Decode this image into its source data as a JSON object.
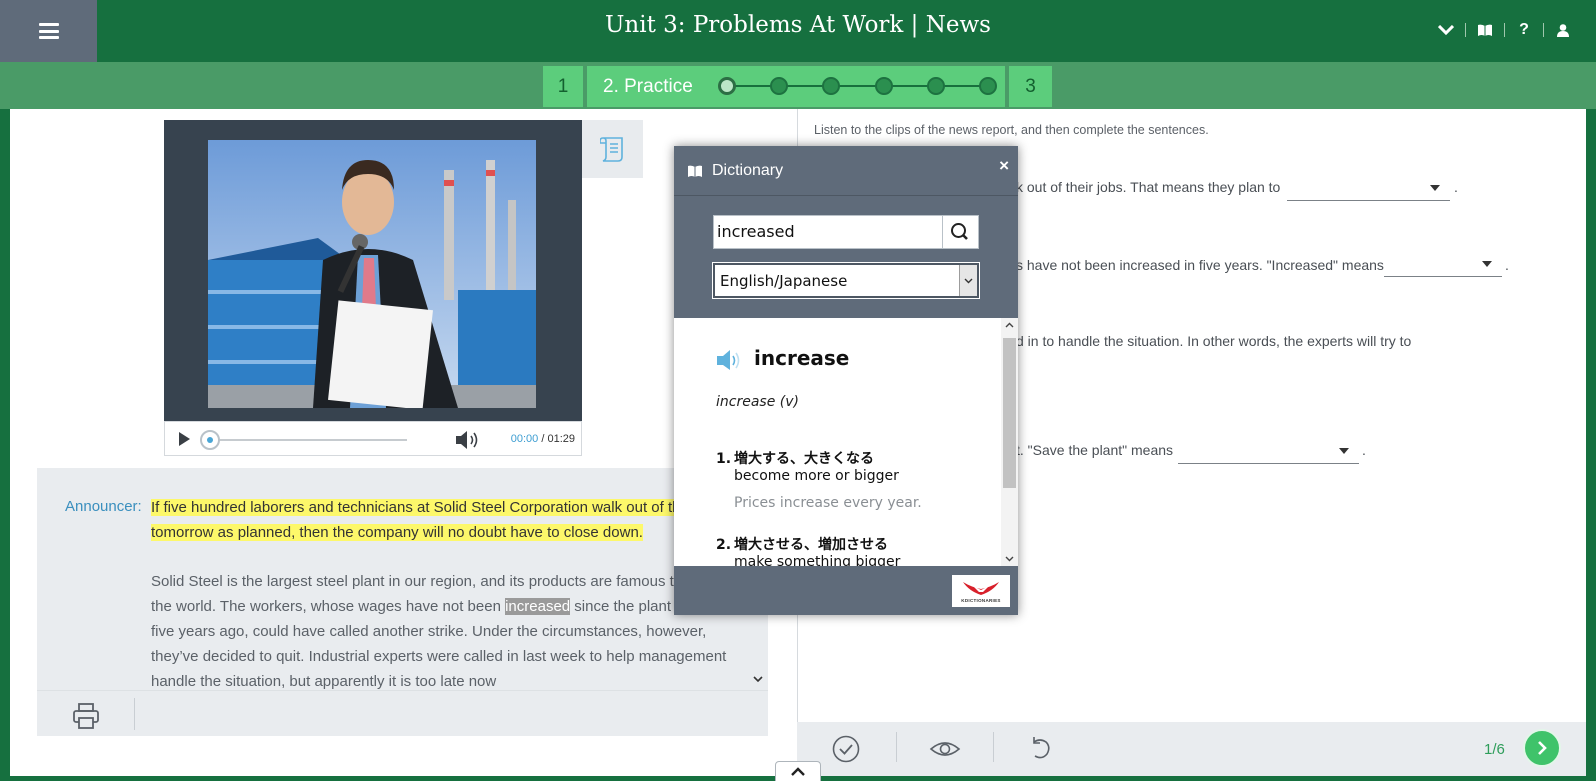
{
  "header": {
    "title": "Unit 3: Problems At Work | News",
    "icons": [
      "menu-icon",
      "chevron-down-icon",
      "book-icon",
      "help-icon",
      "user-icon"
    ],
    "help_label": "?"
  },
  "steps": {
    "step1_label": "1",
    "step2_label": "2. Practice",
    "step3_label": "3",
    "dots_total": 6,
    "active_dot": 1
  },
  "player": {
    "current_time": "00:00",
    "separator": " / ",
    "duration": "01:29"
  },
  "transcript": {
    "speaker": "Announcer:",
    "highlighted_text": "If five hundred laborers and technicians at Solid Steel Corporation walk out of their jobs tomorrow as planned, then the company will no doubt have to close down.",
    "para2_before": "Solid Steel is the largest steel plant in our region, and its products are famous throughout the world. The workers, whose wages have not been ",
    "para2_selected": "increased",
    "para2_after": " since the plant opened five years ago, could have called another strike. Under the circumstances, however, they’ve decided to quit. Industrial experts were called in last week to help management handle the situation, but apparently it is too late now"
  },
  "exercise": {
    "instructions": "Listen to the clips of the news report, and then complete the sentences.",
    "q1": "k out of their jobs. That means they plan to",
    "q2": "s have not been increased in five years. \"Increased\" means",
    "q3": "d in to handle the situation. In other words, the experts will try to",
    "q4": "t. \"Save the plant\" means",
    "period": "."
  },
  "footer": {
    "page_count": "1/6",
    "icons": [
      "check-icon",
      "eye-icon",
      "undo-icon",
      "next-arrow-icon"
    ]
  },
  "dictionary": {
    "title": "Dictionary",
    "close_label": "×",
    "search_value": "increased",
    "language_selected": "English/Japanese",
    "headword": "increase",
    "part_of_speech": "increase (v)",
    "senses": [
      {
        "number": "1.",
        "japanese": "増大する、大きくなる",
        "english": "become more or bigger",
        "example": "Prices increase every year."
      },
      {
        "number": "2.",
        "japanese": "増大させる、増加させる",
        "english": "make something bigger"
      }
    ],
    "logo_text": "KDICTIONARIES"
  },
  "colors": {
    "header_green": "#16703f",
    "step_green": "#5ccd7c",
    "highlight_yellow": "#fdf86a",
    "link_blue": "#3a8fbe",
    "dictionary_gray": "#5f6b7a"
  }
}
